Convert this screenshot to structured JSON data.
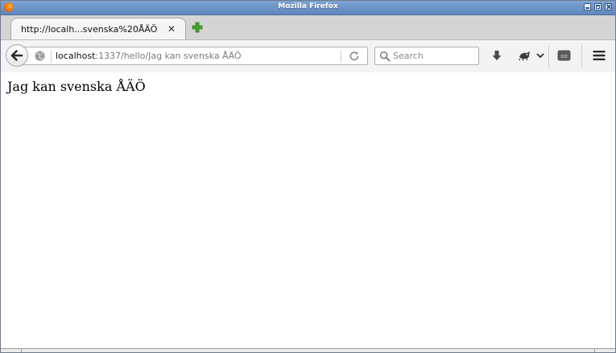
{
  "window": {
    "title": "Mozilla Firefox"
  },
  "tabs": [
    {
      "label": "http://localh...svenska%20ÅÄÖ",
      "close_glyph": "✕"
    }
  ],
  "urlbar": {
    "host": "localhost",
    "path": ":1337/hello/Jag kan svenska ÅÄÖ"
  },
  "search": {
    "placeholder": "Search",
    "value": ""
  },
  "toolbar": {
    "icons": [
      "download-icon",
      "extension-icon",
      "dropdown-arrow-icon",
      "zzz-icon",
      "hamburger-menu-icon"
    ],
    "zzz_label": "zzz"
  },
  "page": {
    "text": "Jag kan svenska ÅÄÖ"
  },
  "colors": {
    "titlebar": "#5f86bd",
    "tabstrip": "#d4d4d4",
    "toolbar": "#f3f3f3",
    "new_tab_plus": "#4aa02c"
  }
}
